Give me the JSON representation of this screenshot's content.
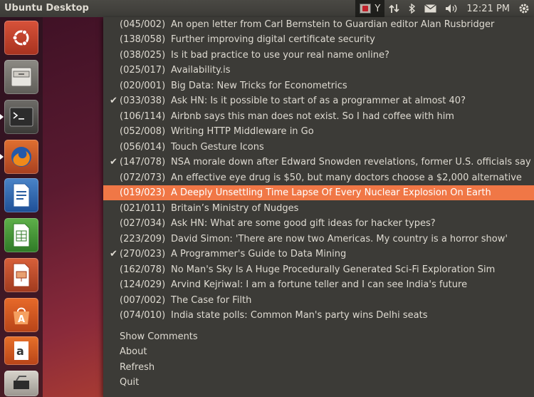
{
  "panel": {
    "title": "Ubuntu Desktop",
    "indicator_hn_letter": "Y",
    "time": "12:21 PM"
  },
  "launcher": {
    "items": [
      "ubuntu-dash-icon",
      "file-cabinet-icon",
      "terminal-icon",
      "firefox-icon",
      "writer-icon",
      "calc-icon",
      "impress-icon",
      "software-center-icon",
      "amazon-icon",
      "settings-icon"
    ]
  },
  "menu": {
    "stories": [
      {
        "count": "(045/002)",
        "title": "An open letter from Carl Bernstein to Guardian editor Alan Rusbridger",
        "checked": false
      },
      {
        "count": "(138/058)",
        "title": "Further improving digital certificate security",
        "checked": false
      },
      {
        "count": "(038/025)",
        "title": "Is it bad practice to use your real name online?",
        "checked": false
      },
      {
        "count": "(025/017)",
        "title": "Availability.is",
        "checked": false
      },
      {
        "count": "(020/001)",
        "title": "Big Data: New Tricks for Econometrics",
        "checked": false
      },
      {
        "count": "(033/038)",
        "title": "Ask HN: Is it possible to start of as a programmer at almost 40?",
        "checked": true
      },
      {
        "count": "(106/114)",
        "title": "Airbnb says this man does not exist. So I had coffee with him",
        "checked": false
      },
      {
        "count": "(052/008)",
        "title": "Writing HTTP Middleware in Go",
        "checked": false
      },
      {
        "count": "(056/014)",
        "title": "Touch Gesture Icons",
        "checked": false
      },
      {
        "count": "(147/078)",
        "title": "NSA morale down after Edward Snowden revelations, former U.S. officials say",
        "checked": true
      },
      {
        "count": "(072/073)",
        "title": "An effective eye drug is $50, but many doctors choose a $2,000 alternative",
        "checked": false
      },
      {
        "count": "(019/023)",
        "title": "A Deeply Unsettling Time Lapse Of Every Nuclear Explosion On Earth",
        "checked": false,
        "highlight": true
      },
      {
        "count": "(021/011)",
        "title": "Britain’s Ministry of Nudges",
        "checked": false
      },
      {
        "count": "(027/034)",
        "title": "Ask HN: What are some good gift ideas for hacker types?",
        "checked": false
      },
      {
        "count": "(223/209)",
        "title": "David Simon: 'There are now two Americas. My country is a horror show'",
        "checked": false
      },
      {
        "count": "(270/023)",
        "title": "A Programmer's Guide to Data Mining",
        "checked": true
      },
      {
        "count": "(162/078)",
        "title": "No Man's Sky Is A Huge Procedurally Generated Sci-Fi Exploration Sim",
        "checked": false
      },
      {
        "count": "(124/029)",
        "title": "Arvind Kejriwal: I am a fortune teller and I can see India's future",
        "checked": false
      },
      {
        "count": "(007/002)",
        "title": "The Case for Filth",
        "checked": false
      },
      {
        "count": "(074/010)",
        "title": "India state polls: Common Man's party wins Delhi seats",
        "checked": false
      }
    ],
    "check_glyph": "✔",
    "actions": [
      "Show Comments",
      "About",
      "Refresh",
      "Quit"
    ]
  },
  "colors": {
    "panel_bg": "#3c3b37",
    "menu_bg": "#3c3b37",
    "highlight": "#f07746",
    "text": "#dfdbd2"
  }
}
